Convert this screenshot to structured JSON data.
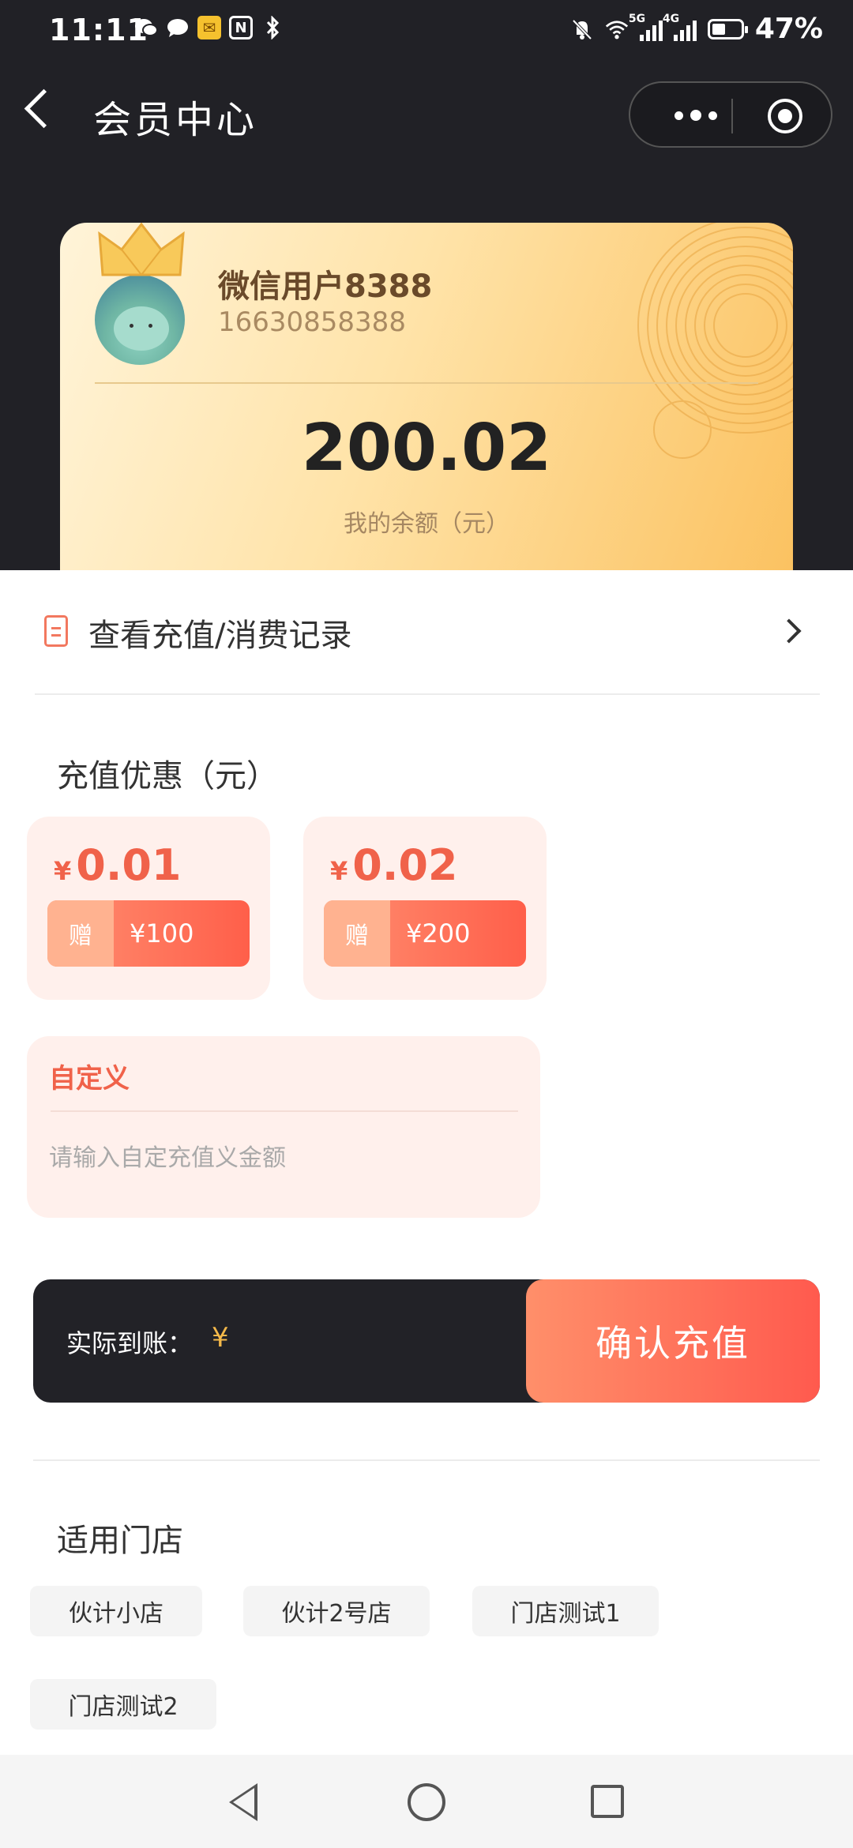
{
  "status_bar": {
    "time": "11:11",
    "battery": "47%",
    "signal_labels": [
      "5G",
      "4G"
    ],
    "icons": [
      "wechat-icon",
      "chat-bubble-icon",
      "mail-icon",
      "nfc-icon",
      "bluetooth-icon",
      "mute-icon",
      "wifi-icon",
      "signal-icon",
      "battery-icon"
    ]
  },
  "nav": {
    "title": "会员中心"
  },
  "card": {
    "user_name": "微信用户8388",
    "phone": "16630858388",
    "balance": "200.02",
    "balance_label": "我的余额（元）"
  },
  "records": {
    "label": "查看充值/消费记录"
  },
  "promo": {
    "title": "充值优惠（元）",
    "options": [
      {
        "yen": "¥",
        "price": "0.01",
        "gift_tag": "赠",
        "gift_amount": "¥100"
      },
      {
        "yen": "¥",
        "price": "0.02",
        "gift_tag": "赠",
        "gift_amount": "¥200"
      }
    ],
    "custom": {
      "title": "自定义",
      "placeholder": "请输入自定充值义金额"
    }
  },
  "pay": {
    "label": "实际到账：",
    "yen": "¥",
    "button": "确认充值"
  },
  "stores": {
    "title": "适用门店",
    "items": [
      "伙计小店",
      "伙计2号店",
      "门店测试1",
      "门店测试2"
    ]
  },
  "colors": {
    "header_bg": "#212126",
    "accent": "#f0624a",
    "card_gold": "#fbc261",
    "pay_gold": "#f5b94a"
  }
}
